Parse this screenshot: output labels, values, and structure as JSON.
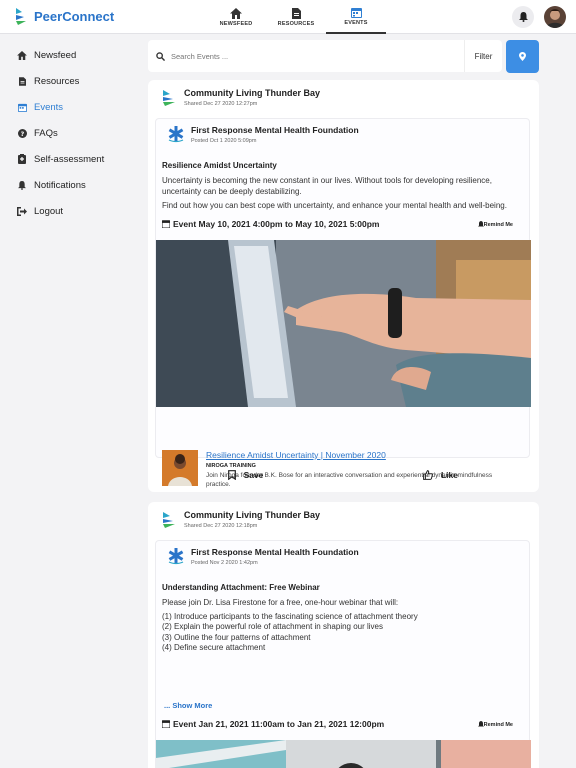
{
  "app": {
    "name": "PeerConnect"
  },
  "nav": {
    "tabs": [
      {
        "label": "NEWSFEED"
      },
      {
        "label": "RESOURCES"
      },
      {
        "label": "EVENTS"
      }
    ]
  },
  "sidebar": {
    "items": [
      {
        "label": "Newsfeed",
        "icon": "home-icon"
      },
      {
        "label": "Resources",
        "icon": "file-icon"
      },
      {
        "label": "Events",
        "icon": "calendar-icon"
      },
      {
        "label": "FAQs",
        "icon": "question-icon"
      },
      {
        "label": "Self-assessment",
        "icon": "clipboard-icon"
      },
      {
        "label": "Notifications",
        "icon": "bell-icon"
      },
      {
        "label": "Logout",
        "icon": "logout-icon"
      }
    ]
  },
  "search": {
    "placeholder": "Search Events ...",
    "filter_label": "Filter"
  },
  "colors": {
    "brand_blue": "#2a74c9",
    "accent": "#3d8ee4"
  },
  "posts": [
    {
      "author": "Community Living Thunder Bay",
      "shared": "Shared Dec 27 2020 12:27pm",
      "org": "First Response Mental Health Foundation",
      "posted": "Posted Oct 1 2020 5:09pm",
      "heading": "Resilience Amidst Uncertainty",
      "body": [
        "Uncertainty is becoming the new constant in our lives. Without tools for developing resilience, uncertainty can be deeply destabilizing.",
        "Find out how you can best cope with uncertainty, and enhance your mental health and well-being."
      ],
      "event": "Event May 10, 2021 4:00pm to May 10, 2021 5:00pm",
      "remind": "Remind Me",
      "link": {
        "title": "Resilience Amidst Uncertainty | November 2020",
        "source": "NIROGA TRAINING",
        "desc": "Join Niroga founder B.K. Bose for an interactive conversation and experiential dynamic mindfulness practice."
      },
      "save_label": "Save",
      "like_label": "Like"
    },
    {
      "author": "Community Living Thunder Bay",
      "shared": "Shared Dec 27 2020 12:18pm",
      "org": "First Response Mental Health Foundation",
      "posted": "Posted Nov 2 2020 1:42pm",
      "heading": "Understanding Attachment: Free Webinar",
      "body": [
        "Please join Dr. Lisa Firestone for a free, one-hour webinar that will:",
        "(1) Introduce participants to the fascinating science of attachment theory",
        "(2) Explain the powerful role of attachment in shaping our lives",
        "(3) Outline the four patterns of attachment",
        "(4) Define secure attachment"
      ],
      "show_more": "... Show More",
      "event": "Event Jan 21, 2021 11:00am to Jan 21, 2021 12:00pm",
      "remind": "Remind Me"
    }
  ]
}
